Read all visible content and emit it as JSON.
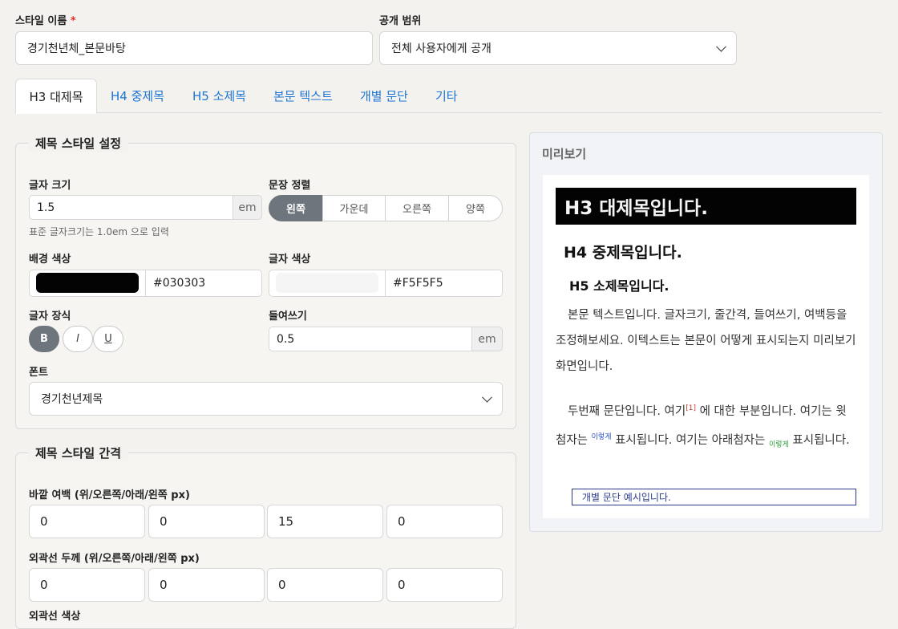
{
  "header": {
    "style_name_label": "스타일 이름",
    "required_mark": "*",
    "style_name_value": "경기천년체_본문바탕",
    "visibility_label": "공개 범위",
    "visibility_value": "전체 사용자에게 공개"
  },
  "tabs": [
    {
      "label": "H3 대제목",
      "active": true
    },
    {
      "label": "H4 중제목"
    },
    {
      "label": "H5 소제목"
    },
    {
      "label": "본문 텍스트"
    },
    {
      "label": "개별 문단"
    },
    {
      "label": "기타"
    }
  ],
  "heading_style": {
    "legend": "제목 스타일 설정",
    "font_size_label": "글자 크기",
    "font_size_value": "1.5",
    "font_size_unit": "em",
    "font_size_hint": "표준 글자크기는 1.0em 으로 입력",
    "align_label": "문장 정렬",
    "align_options": [
      "왼쪽",
      "가운데",
      "오른쪽",
      "양쪽"
    ],
    "align_selected": "왼쪽",
    "bg_color_label": "배경 색상",
    "bg_color_value": "#030303",
    "text_color_label": "글자 색상",
    "text_color_value": "#F5F5F5",
    "decoration_label": "글자 장식",
    "decoration_buttons": [
      "B",
      "I",
      "U"
    ],
    "indent_label": "들여쓰기",
    "indent_value": "0.5",
    "indent_unit": "em",
    "font_label": "폰트",
    "font_value": "경기천년제목"
  },
  "heading_spacing": {
    "legend": "제목 스타일 간격",
    "margin_label": "바깥 여백 (위/오른쪽/아래/왼쪽 px)",
    "margin_values": [
      "0",
      "0",
      "15",
      "0"
    ],
    "border_label": "외곽선 두께 (위/오른쪽/아래/왼쪽 px)",
    "border_values": [
      "0",
      "0",
      "0",
      "0"
    ],
    "border_color_label": "외곽선 색상"
  },
  "preview": {
    "title": "미리보기",
    "h3": "H3 대제목입니다.",
    "h4": "H4 중제목입니다.",
    "h5": "H5 소제목입니다.",
    "p1": "본문 텍스트입니다. 글자크기, 줄간격, 들여쓰기, 여백등을 조정해보세요. 이텍스트는 본문이 어떻게 표시되는지 미리보기 화면입니다.",
    "p2_a": "두번째 문단입니다. 여기",
    "p2_sup": "[1]",
    "p2_b": " 에 대한 부분입니다. 여기는 윗첨자는 ",
    "p2_sup_word": "이렇게",
    "p2_c": " 표시됩니다. 여기는 아래첨자는 ",
    "p2_sub_word": "이렇게",
    "p2_d": " 표시됩니다.",
    "box_text": "개별 문단 예시입니다."
  },
  "colors": {
    "accent_tab": "#1c74d4",
    "segment_active": "#6e757c",
    "bg_swatch": "#030303",
    "text_swatch": "#F5F5F5"
  }
}
